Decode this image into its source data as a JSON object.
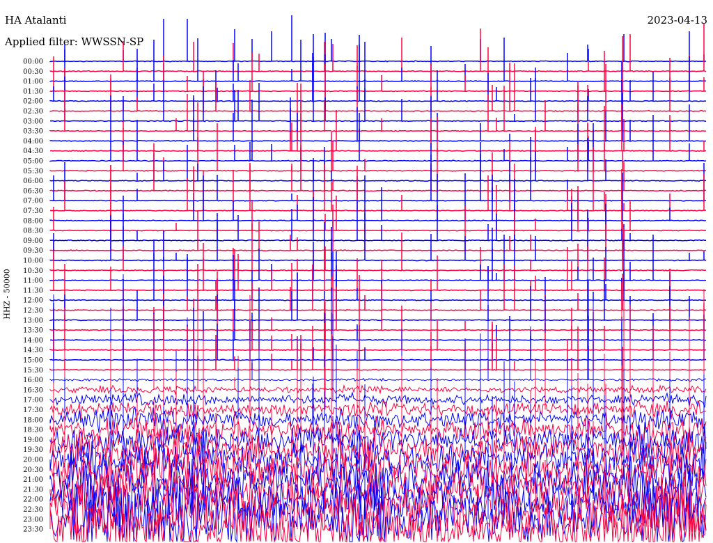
{
  "chart_data": {
    "type": "line",
    "title": "HA Atalanti",
    "date": "2023-04-13",
    "filter_text": "Applied filter: WWSSN-SP",
    "ylabel": "HHZ - 50000",
    "xlabel": "",
    "row_labels": [
      "00:00",
      "00:30",
      "01:00",
      "01:30",
      "02:00",
      "02:30",
      "03:00",
      "03:30",
      "04:00",
      "04:30",
      "05:00",
      "05:30",
      "06:00",
      "06:30",
      "07:00",
      "07:30",
      "08:00",
      "08:30",
      "09:00",
      "09:30",
      "10:00",
      "10:30",
      "11:00",
      "11:30",
      "12:00",
      "12:30",
      "13:00",
      "13:30",
      "14:00",
      "14:30",
      "15:00",
      "15:30",
      "16:00",
      "16:30",
      "17:00",
      "17:30",
      "18:00",
      "18:30",
      "19:00",
      "19:30",
      "20:00",
      "20:30",
      "21:00",
      "21:30",
      "22:00",
      "22:30",
      "23:00",
      "23:30"
    ],
    "trace_colors": [
      "#0000ff",
      "#ff0040"
    ],
    "noise_onset_row": "16:00"
  }
}
